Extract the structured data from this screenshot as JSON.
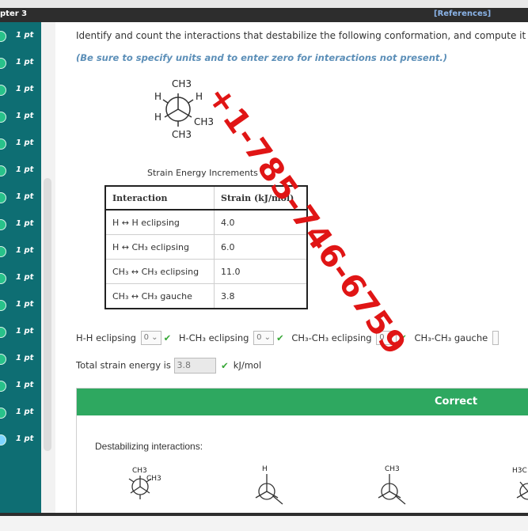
{
  "header": {
    "chapter": "pter 3",
    "references": "[References]"
  },
  "sidebar": {
    "items": [
      "1 pt",
      "1 pt",
      "1 pt",
      "1 pt",
      "1 pt",
      "1 pt",
      "1 pt",
      "1 pt",
      "1 pt",
      "1 pt",
      "1 pt",
      "1 pt",
      "1 pt",
      "1 pt",
      "1 pt",
      "1 pt"
    ]
  },
  "question": {
    "text": "Identify and count the interactions that destabilize the following conformation, and compute it",
    "note": "(Be sure to specify units and to enter zero for interactions not present.)"
  },
  "newman": {
    "top": "CH3",
    "upper_left": "H",
    "upper_right": "H",
    "lower_left": "H",
    "lower_right": "CH3",
    "bottom": "CH3"
  },
  "table": {
    "caption": "Strain Energy Increments",
    "headers": [
      "Interaction",
      "Strain (kJ/mol)"
    ],
    "rows": [
      [
        "H ↔ H eclipsing",
        "4.0"
      ],
      [
        "H ↔ CH₃ eclipsing",
        "6.0"
      ],
      [
        "CH₃ ↔ CH₃ eclipsing",
        "11.0"
      ],
      [
        "CH₃ ↔ CH₃ gauche",
        "3.8"
      ]
    ]
  },
  "answers": {
    "hh": {
      "label": "H-H eclipsing",
      "value": "0"
    },
    "hch3": {
      "label": "H-CH₃ eclipsing",
      "value": "0"
    },
    "ch3ch3e": {
      "label": "CH₃-CH₃ eclipsing",
      "value": "0"
    },
    "ch3ch3g": {
      "label": "CH₃-CH₃ gauche",
      "value": ""
    }
  },
  "total": {
    "label": "Total strain energy is",
    "value": "3.8",
    "unit": "kJ/mol"
  },
  "result": {
    "banner": "Correct",
    "destabilizing_label": "Destabilizing interactions:",
    "mini1_top": "CH3",
    "mini1_side": "CH3",
    "mini2_top": "H",
    "mini3_top": "CH3",
    "mini4_top": "H3C"
  },
  "watermark": "+1-785-746-6759",
  "colors": {
    "sidebar": "#0e6e73",
    "check": "#38a838",
    "banner": "#2ea860",
    "watermark": "#e01515"
  }
}
